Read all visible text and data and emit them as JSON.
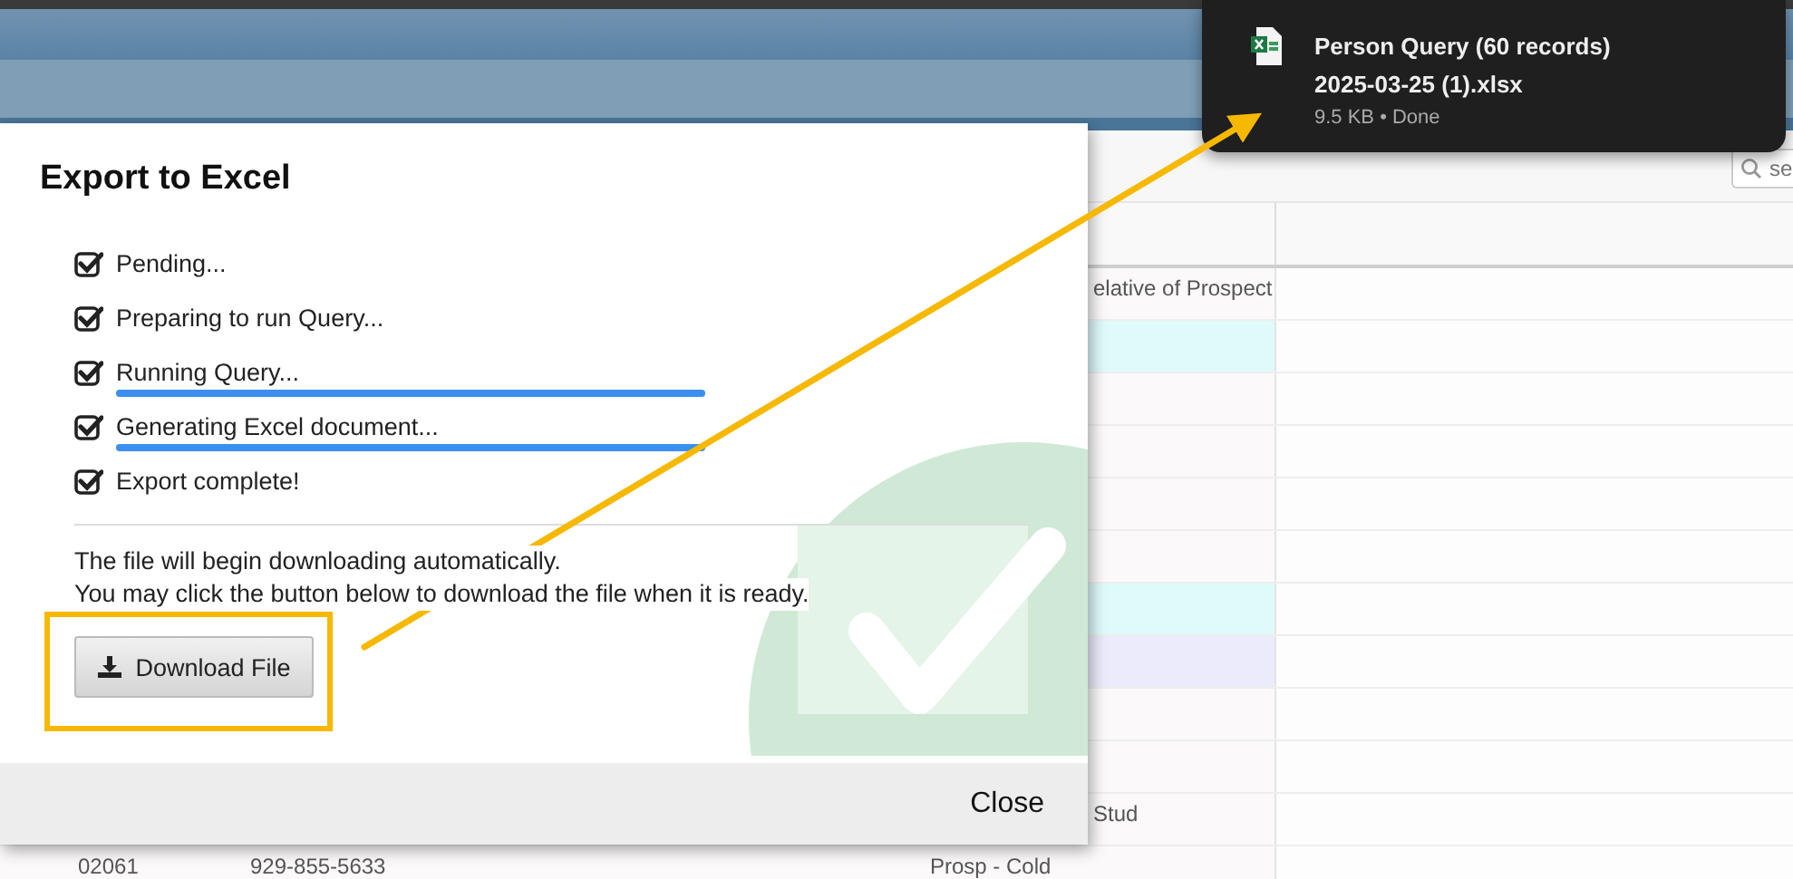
{
  "dialog": {
    "title": "Export to Excel",
    "steps": [
      {
        "label": "Pending...",
        "checked": true
      },
      {
        "label": "Preparing to run Query...",
        "checked": true
      },
      {
        "label": "Running Query...",
        "checked": true,
        "progress": {
          "level": 1
        }
      },
      {
        "label": "Generating Excel document...",
        "checked": true,
        "progress": {
          "level": 1
        }
      },
      {
        "label": "Export complete!",
        "checked": true
      }
    ],
    "message": [
      "The file will begin downloading automatically.",
      "You may click the button below to download the file when it is ready."
    ],
    "download_button": "Download File",
    "close_button": "Close"
  },
  "download_toast": {
    "title": "Person Query (60 records)",
    "filename": "2025-03-25 (1).xlsx",
    "status": "9.5 KB • Done"
  },
  "search": {
    "placeholder": "se"
  },
  "table": {
    "rows": [
      {
        "color": "#fbf9fa",
        "column_6": "elative of Prospect"
      },
      {
        "color": "#dffafb"
      },
      {
        "color": "#fbf9fa"
      },
      {
        "color": "#fbf9fa"
      },
      {
        "color": "#fbf9fa"
      },
      {
        "color": "#fbf9fa"
      },
      {
        "color": "#dffafb"
      },
      {
        "color": "#ecebfb"
      },
      {
        "color": "#fbf9fa"
      },
      {
        "color": "#fbf9fa"
      },
      {
        "color": "#fbf9fa",
        "column_6": "Stud"
      },
      {
        "color": "#fbf9fa",
        "column_1": "02061",
        "column_2": "929-855-5633",
        "column_5": "Prosp - Cold"
      }
    ]
  }
}
